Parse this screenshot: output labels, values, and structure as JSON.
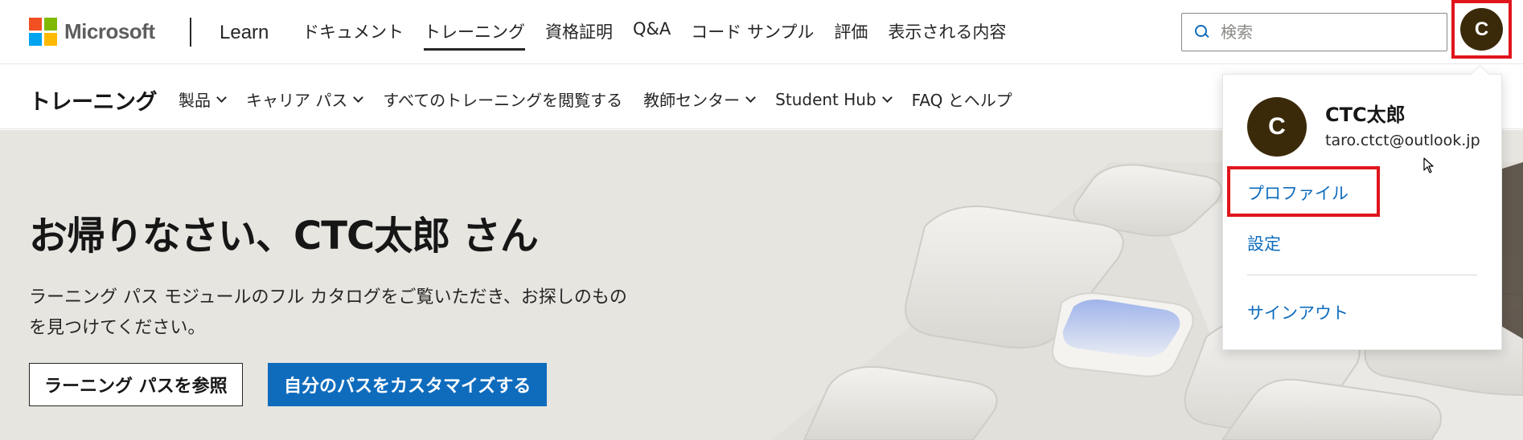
{
  "brand": {
    "company": "Microsoft",
    "product": "Learn",
    "logo_colors": [
      "#f25022",
      "#7fba00",
      "#00a4ef",
      "#ffb900"
    ]
  },
  "topnav": {
    "links": [
      {
        "label": "ドキュメント",
        "active": false
      },
      {
        "label": "トレーニング",
        "active": true
      },
      {
        "label": "資格証明",
        "active": false
      },
      {
        "label": "Q&A",
        "active": false
      },
      {
        "label": "コード サンプル",
        "active": false
      },
      {
        "label": "評価",
        "active": false
      },
      {
        "label": "表示される内容",
        "active": false
      }
    ],
    "search_placeholder": "検索",
    "avatar_initial": "C"
  },
  "subnav": {
    "title": "トレーニング",
    "items": [
      {
        "label": "製品",
        "dropdown": true
      },
      {
        "label": "キャリア パス",
        "dropdown": true
      },
      {
        "label": "すべてのトレーニングを閲覧する",
        "dropdown": false
      },
      {
        "label": "教師センター",
        "dropdown": true
      },
      {
        "label": "Student Hub",
        "dropdown": true
      },
      {
        "label": "FAQ とヘルプ",
        "dropdown": false
      }
    ]
  },
  "hero": {
    "heading": "お帰りなさい、CTC太郎 さん",
    "description": "ラーニング パス モジュールのフル カタログをご覧いただき、お探しのものを見つけてください。",
    "button_browse": "ラーニング パスを参照",
    "button_customize": "自分のパスをカスタマイズする"
  },
  "profile_menu": {
    "avatar_initial": "C",
    "name": "CTC太郎",
    "email": "taro.ctct@outlook.jp",
    "profile_label": "プロファイル",
    "settings_label": "設定",
    "signout_label": "サインアウト"
  },
  "colors": {
    "accent": "#0f6cbd",
    "highlight_box": "#e0151c",
    "avatar_bg": "#3b2a0a",
    "hero_bg": "#e7e5e0"
  }
}
